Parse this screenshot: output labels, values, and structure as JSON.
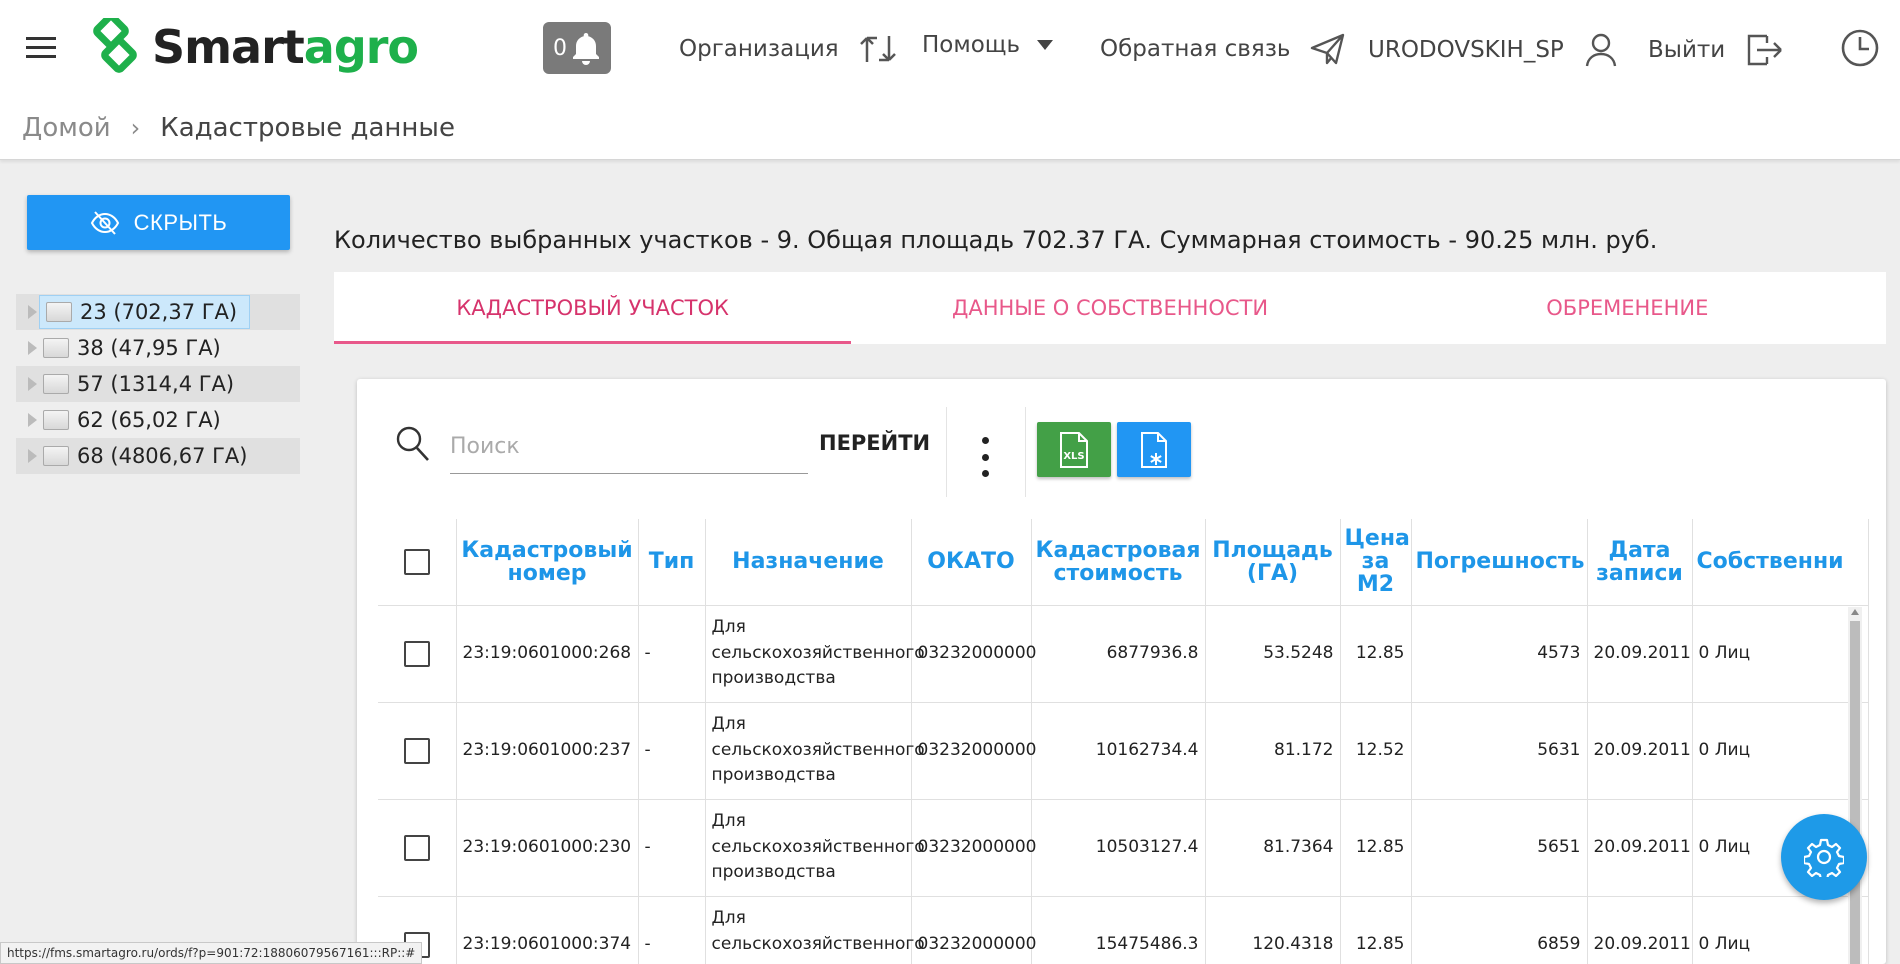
{
  "header": {
    "logo_smart": "Smart",
    "logo_agro": "agro",
    "notifications_count": "0",
    "organization_label": "Организация",
    "help_label": "Помощь",
    "feedback_label": "Обратная связь",
    "username": "URODOVSKIH_SP",
    "logout_label": "Выйти"
  },
  "breadcrumb": {
    "home": "Домой",
    "current": "Кадастровые данные"
  },
  "sidebar": {
    "hide_button": "СКРЫТЬ",
    "tree": [
      {
        "label": "23 (702,37 ГА)",
        "selected": true
      },
      {
        "label": "38 (47,95 ГА)"
      },
      {
        "label": "57 (1314,4 ГА)"
      },
      {
        "label": "62 (65,02 ГА)"
      },
      {
        "label": "68 (4806,67 ГА)"
      }
    ]
  },
  "summary": "Количество выбранных участков - 9. Общая площадь 702.37 ГА. Суммарная стоимость - 90.25 млн. руб.",
  "tabs": [
    {
      "label": "КАДАСТРОВЫЙ УЧАСТОК",
      "active": true
    },
    {
      "label": "ДАННЫЕ О СОБСТВЕННОСТИ"
    },
    {
      "label": "ОБРЕМЕНЕНИЕ"
    }
  ],
  "toolbar": {
    "search_placeholder": "Поиск",
    "go_label": "ПЕРЕЙТИ",
    "xls_label": "XLS"
  },
  "table": {
    "columns": [
      "Кадастровый номер",
      "Тип",
      "Назначение",
      "ОКАТО",
      "Кадастровая стоимость",
      "Площадь (ГА)",
      "Цена за М2",
      "Погрешность",
      "Дата записи",
      "Собственни"
    ],
    "rows": [
      [
        "23:19:0601000:268",
        "-",
        "Для сельскохозяйственного производства",
        "03232000000",
        "6877936.8",
        "53.5248",
        "12.85",
        "4573",
        "20.09.2011",
        "0 Лиц"
      ],
      [
        "23:19:0601000:237",
        "-",
        "Для сельскохозяйственного производства",
        "03232000000",
        "10162734.4",
        "81.172",
        "12.52",
        "5631",
        "20.09.2011",
        "0 Лиц"
      ],
      [
        "23:19:0601000:230",
        "-",
        "Для сельскохозяйственного производства",
        "03232000000",
        "10503127.4",
        "81.7364",
        "12.85",
        "5651",
        "20.09.2011",
        "0 Лиц"
      ],
      [
        "23:19:0601000:374",
        "-",
        "Для сельскохозяйственного производства",
        "03232000000",
        "15475486.3",
        "120.4318",
        "12.85",
        "6859",
        "20.09.2011",
        "0 Лиц"
      ]
    ]
  },
  "status_url": "https://fms.smartagro.ru/ords/f?p=901:72:18806079567161:::RP::#",
  "colors": {
    "accent_blue": "#2196f3",
    "header_text_blue": "#1e96e8",
    "tab_pink": "#e8588a",
    "logo_green": "#1eb04b",
    "xls_green": "#43a047"
  }
}
